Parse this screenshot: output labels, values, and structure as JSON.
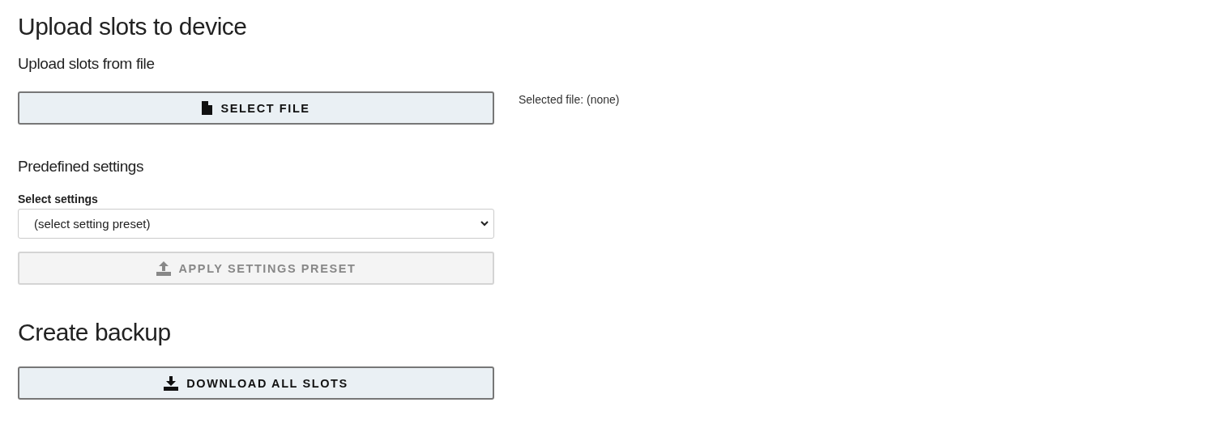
{
  "title": "Upload slots to device",
  "upload_from_file": {
    "heading": "Upload slots from file",
    "button": {
      "label": "SELECT FILE",
      "kind": "file",
      "disabled": false
    },
    "selected_file": "Selected file: (none)"
  },
  "predefined": {
    "heading": "Predefined settings",
    "select_label": "Select settings",
    "select_value": "(select setting preset)",
    "button": {
      "label": "APPLY SETTINGS PRESET",
      "kind": "upload",
      "disabled": true
    }
  },
  "backup": {
    "heading": "Create backup",
    "button": {
      "label": "DOWNLOAD ALL SLOTS",
      "kind": "download",
      "disabled": false
    }
  }
}
